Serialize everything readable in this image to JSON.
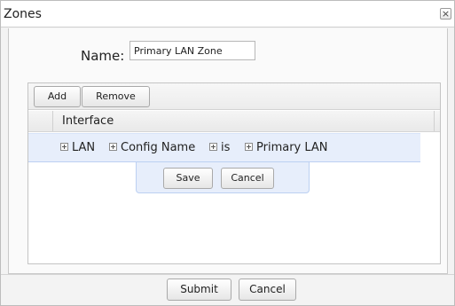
{
  "dialog": {
    "title": "Zones",
    "close_label": "×"
  },
  "form": {
    "name_label": "Name:",
    "name_value": "Primary LAN Zone"
  },
  "grid": {
    "toolbar": {
      "add_label": "Add",
      "remove_label": "Remove"
    },
    "columns": [
      "Interface"
    ],
    "edit_row": {
      "conditions": [
        "LAN",
        "Config Name",
        "is",
        "Primary LAN"
      ]
    },
    "editor": {
      "save_label": "Save",
      "cancel_label": "Cancel"
    }
  },
  "footer": {
    "submit_label": "Submit",
    "cancel_label": "Cancel"
  },
  "icons": {
    "close": "close-icon",
    "expand": "plus-box-icon"
  }
}
